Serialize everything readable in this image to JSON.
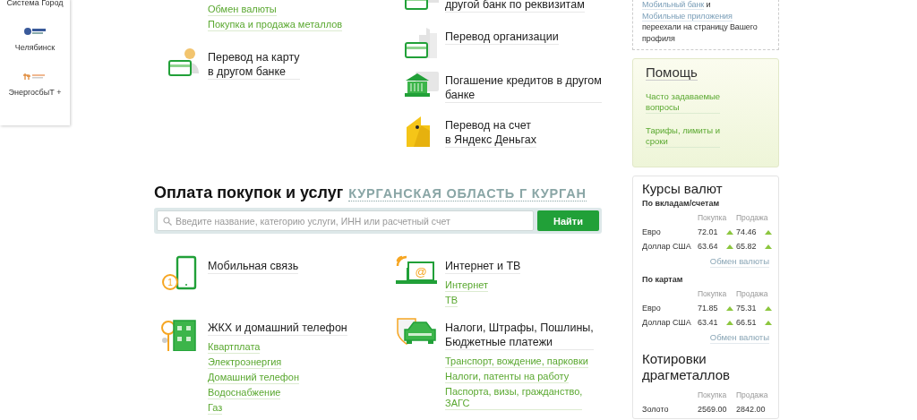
{
  "partners": [
    {
      "name": "Система Город"
    },
    {
      "name": "Челябинск"
    },
    {
      "name": "ЭнергосбыТ +"
    }
  ],
  "transfers": {
    "columns": [
      [
        {
          "links": [
            "Обмен валюты",
            "Покупка и продажа металлов"
          ]
        },
        {
          "title": "Перевод на карту\nв другом банке"
        }
      ],
      [
        {
          "title": "другой банк по реквизитам"
        },
        {
          "title": "Перевод организации"
        },
        {
          "title": "Погашение кредитов в другом\nбанке"
        },
        {
          "title": "Перевод на счет\nв Яндекс Деньгах"
        }
      ]
    ]
  },
  "payments": {
    "title": "Оплата покупок и услуг",
    "region": "КУРГАНСКАЯ ОБЛАСТЬ Г КУРГАН",
    "search": {
      "placeholder": "Введите название, категорию услуги, ИНН или расчетный счет",
      "button": "Найти"
    },
    "services": [
      {
        "title": "Мобильная связь",
        "badge": "1"
      },
      {
        "title": "Интернет и ТВ",
        "badge": "@",
        "links": [
          "Интернет",
          "ТВ"
        ]
      },
      {
        "title": "ЖКХ и домашний телефон",
        "links": [
          "Квартплата",
          "Электроэнергия",
          "Домашний телефон",
          "Водоснабжение",
          "Газ"
        ]
      },
      {
        "title": "Налоги, Штрафы, Пошлины,\nБюджетные платежи",
        "links": [
          "Транспорт, вождение, парковки",
          "Налоги, патенты на работу",
          "Паспорта, визы, гражданство,\nЗАГС"
        ]
      }
    ]
  },
  "notice": [
    {
      "kind": "link",
      "text": "Мобильный банк"
    },
    {
      "kind": "plain",
      "text": " и "
    },
    {
      "kind": "link",
      "text": "Мобильные приложения"
    },
    {
      "kind": "plain",
      "text": " переехали на страницу Вашего профиля"
    }
  ],
  "help": {
    "title": "Помощь",
    "links": [
      "Часто задаваемые\nвопросы",
      "Тарифы, лимиты и\nсроки"
    ]
  },
  "rates": {
    "title": "Курсы валют",
    "groups": [
      {
        "subtitle": "По вкладам/счетам",
        "columns": [
          "Покупка",
          "Продажа"
        ],
        "rows": [
          {
            "name": "Евро",
            "buy": "72.01",
            "sell": "74.46"
          },
          {
            "name": "Доллар США",
            "buy": "63.64",
            "sell": "65.82"
          }
        ],
        "link": "Обмен валюты"
      },
      {
        "subtitle": "По картам",
        "columns": [
          "Покупка",
          "Продажа"
        ],
        "rows": [
          {
            "name": "Евро",
            "buy": "71.85",
            "sell": "75.31"
          },
          {
            "name": "Доллар США",
            "buy": "63.41",
            "sell": "66.51"
          }
        ],
        "link": "Обмен валюты"
      }
    ]
  },
  "metals": {
    "title": "Котировки\nдрагметаллов",
    "columns": [
      "Покупка",
      "Продажа"
    ],
    "rows": [
      {
        "name": "Золото",
        "buy": "2569.00",
        "sell": "2842.00"
      }
    ]
  }
}
